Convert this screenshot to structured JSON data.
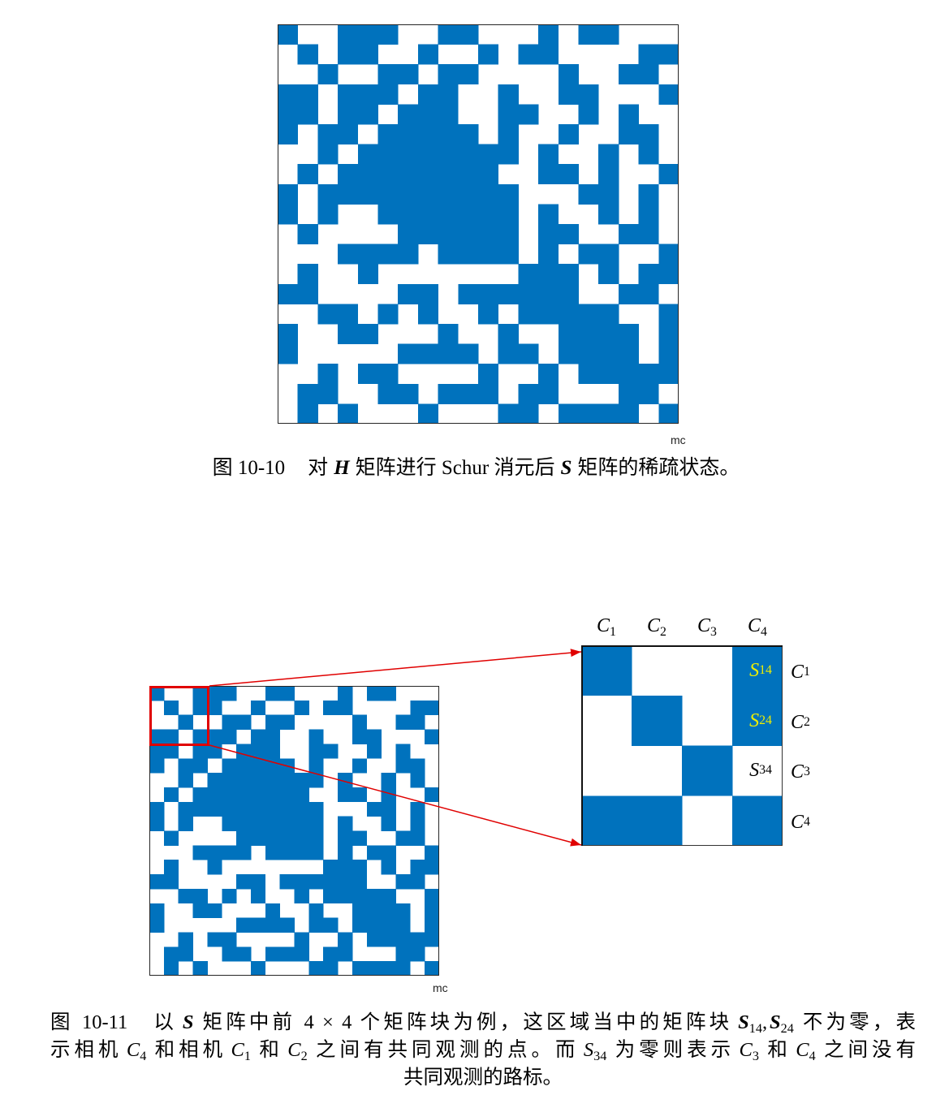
{
  "figure_10_10": {
    "footnote": "mc",
    "caption": {
      "number": "图 10-10",
      "t1": "对",
      "m1": "H",
      "t2": "矩阵进行 Schur 消元后",
      "m2": "S",
      "t3": "矩阵的稀疏状态。"
    }
  },
  "figure_10_11": {
    "footnote": "mc",
    "zoom": {
      "columns": [
        {
          "base": "C",
          "sub": "1"
        },
        {
          "base": "C",
          "sub": "2"
        },
        {
          "base": "C",
          "sub": "3"
        },
        {
          "base": "C",
          "sub": "4"
        }
      ],
      "rows": [
        {
          "base": "C",
          "sub": "1"
        },
        {
          "base": "C",
          "sub": "2"
        },
        {
          "base": "C",
          "sub": "3"
        },
        {
          "base": "C",
          "sub": "4"
        }
      ],
      "blocks": [
        {
          "base": "S",
          "sub": "14",
          "color": "#EEEE00"
        },
        {
          "base": "S",
          "sub": "24",
          "color": "#EEEE00"
        },
        {
          "base": "S",
          "sub": "34",
          "color": "#000000"
        }
      ]
    },
    "caption": {
      "number": "图 10-11",
      "line1": {
        "t1": "以",
        "m1": "S",
        "t2": "矩阵中前 4 × 4 个矩阵块为例，这区域当中的矩阵块",
        "m2": "S",
        "m2_sub": "14",
        "t3": ",",
        "m3": "S",
        "m3_sub": "24",
        "t4": "不为零，表"
      },
      "line2": {
        "t1": "示相机",
        "m1": "C",
        "m1_sub": "4",
        "t2": "和相机",
        "m2": "C",
        "m2_sub": "1",
        "t3": "和",
        "m3": "C",
        "m3_sub": "2",
        "t4": "之间有共同观测的点。而",
        "m4": "S",
        "m4_sub": "34",
        "t5": "为零则表示",
        "m5": "C",
        "m5_sub": "3",
        "t6": "和",
        "m6": "C",
        "m6_sub": "4",
        "t7": "之间没有"
      },
      "line3": {
        "t1": "共同观测的路标。"
      }
    }
  },
  "colors": {
    "nonzero": "#0072BD",
    "highlight": "#E00000"
  },
  "sparsity_matrix": [
    [
      1,
      0,
      0,
      1,
      1,
      1,
      0,
      0,
      1,
      1,
      0,
      0,
      0,
      1,
      0,
      1,
      1,
      0,
      0,
      0
    ],
    [
      0,
      1,
      0,
      1,
      1,
      0,
      0,
      1,
      0,
      0,
      1,
      0,
      1,
      1,
      0,
      0,
      0,
      0,
      1,
      1
    ],
    [
      0,
      0,
      1,
      0,
      0,
      1,
      1,
      0,
      1,
      1,
      0,
      0,
      0,
      0,
      1,
      0,
      0,
      1,
      1,
      0
    ],
    [
      1,
      1,
      0,
      1,
      1,
      1,
      0,
      1,
      1,
      0,
      0,
      1,
      0,
      0,
      1,
      1,
      0,
      0,
      0,
      1
    ],
    [
      1,
      1,
      0,
      1,
      1,
      0,
      1,
      1,
      1,
      0,
      0,
      1,
      1,
      0,
      0,
      1,
      0,
      1,
      0,
      0
    ],
    [
      1,
      0,
      1,
      1,
      0,
      1,
      1,
      1,
      1,
      1,
      0,
      1,
      0,
      0,
      1,
      0,
      0,
      1,
      1,
      0
    ],
    [
      0,
      0,
      1,
      0,
      1,
      1,
      1,
      1,
      1,
      1,
      1,
      1,
      0,
      1,
      0,
      0,
      1,
      0,
      1,
      0
    ],
    [
      0,
      1,
      0,
      1,
      1,
      1,
      1,
      1,
      1,
      1,
      1,
      0,
      0,
      1,
      1,
      0,
      1,
      0,
      0,
      1
    ],
    [
      1,
      0,
      1,
      1,
      1,
      1,
      1,
      1,
      1,
      1,
      1,
      1,
      0,
      0,
      0,
      1,
      1,
      0,
      1,
      0
    ],
    [
      1,
      0,
      1,
      0,
      0,
      1,
      1,
      1,
      1,
      1,
      1,
      1,
      0,
      1,
      0,
      0,
      1,
      0,
      1,
      0
    ],
    [
      0,
      1,
      0,
      0,
      0,
      0,
      1,
      1,
      1,
      1,
      1,
      1,
      0,
      1,
      1,
      0,
      0,
      1,
      1,
      0
    ],
    [
      0,
      0,
      0,
      1,
      1,
      1,
      1,
      0,
      1,
      1,
      1,
      1,
      0,
      1,
      0,
      1,
      1,
      0,
      0,
      1
    ],
    [
      0,
      1,
      0,
      0,
      1,
      0,
      0,
      0,
      0,
      0,
      0,
      0,
      1,
      1,
      1,
      0,
      1,
      0,
      1,
      1
    ],
    [
      1,
      1,
      0,
      0,
      0,
      0,
      1,
      1,
      0,
      1,
      1,
      1,
      1,
      1,
      1,
      0,
      0,
      1,
      1,
      0
    ],
    [
      0,
      0,
      1,
      1,
      0,
      1,
      0,
      1,
      0,
      0,
      1,
      0,
      1,
      1,
      1,
      1,
      1,
      0,
      0,
      1
    ],
    [
      1,
      0,
      0,
      1,
      1,
      0,
      0,
      0,
      1,
      0,
      0,
      1,
      0,
      0,
      1,
      1,
      1,
      1,
      0,
      1
    ],
    [
      1,
      0,
      0,
      0,
      0,
      0,
      1,
      1,
      1,
      1,
      0,
      1,
      1,
      0,
      1,
      1,
      1,
      1,
      0,
      1
    ],
    [
      0,
      0,
      1,
      0,
      1,
      1,
      0,
      0,
      0,
      0,
      1,
      0,
      0,
      1,
      0,
      1,
      1,
      1,
      1,
      1
    ],
    [
      0,
      1,
      1,
      0,
      0,
      1,
      1,
      0,
      1,
      1,
      1,
      0,
      1,
      1,
      0,
      0,
      0,
      1,
      1,
      0
    ],
    [
      0,
      1,
      0,
      1,
      0,
      0,
      0,
      1,
      0,
      0,
      0,
      1,
      1,
      0,
      1,
      1,
      1,
      1,
      0,
      1
    ]
  ]
}
